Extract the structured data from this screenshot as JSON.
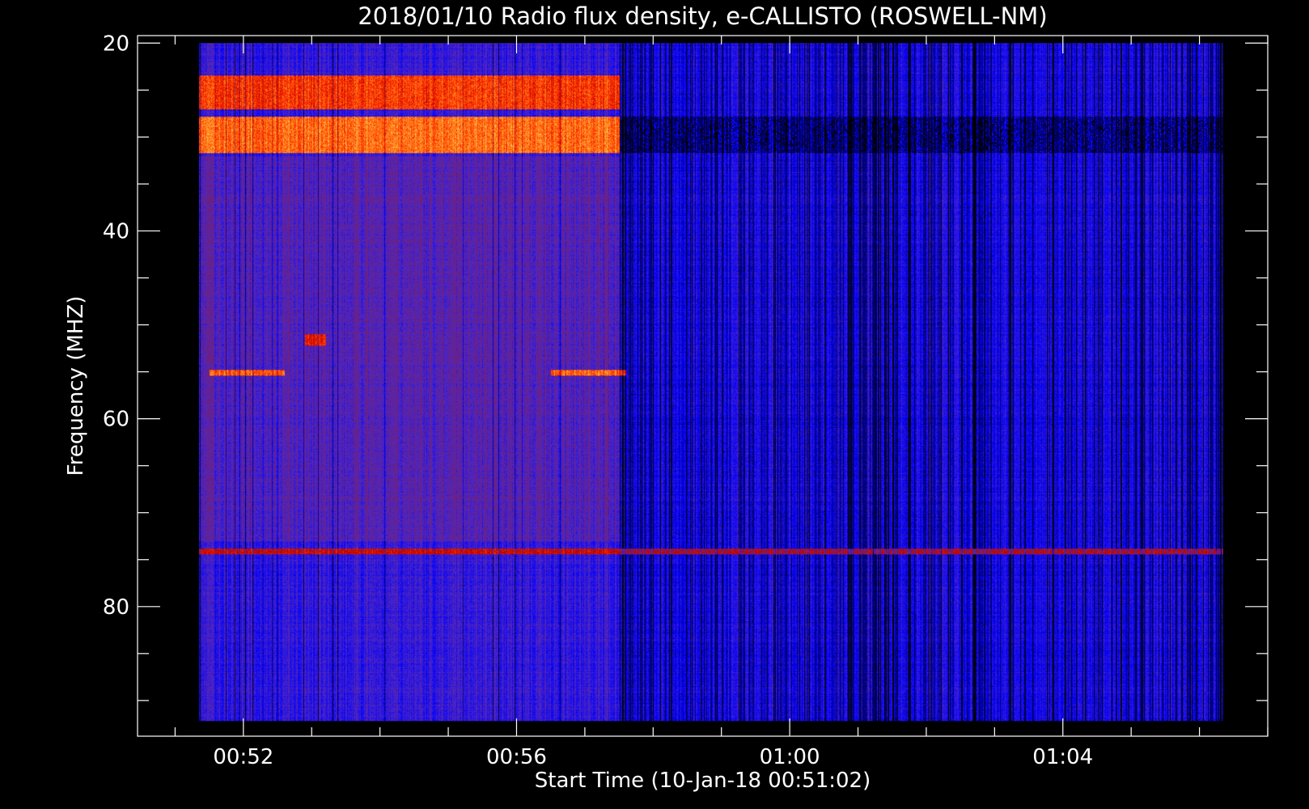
{
  "chart_data": {
    "type": "heatmap",
    "title": "2018/01/10  Radio flux density, e-CALLISTO (ROSWELL-NM)",
    "xlabel": "Start Time (10-Jan-18 00:51:02)",
    "ylabel": "Frequency (MHZ)",
    "x_range_minutes": [
      50.45,
      67.0
    ],
    "data_range_minutes": [
      51.35,
      66.35
    ],
    "ylim": [
      19.2,
      93.8
    ],
    "freq_range_mhz": [
      20,
      92.2
    ],
    "x_ticks": [
      {
        "value": 52,
        "label": "00:52"
      },
      {
        "value": 56,
        "label": "00:56"
      },
      {
        "value": 60,
        "label": "01:00"
      },
      {
        "value": 64,
        "label": "01:04"
      }
    ],
    "y_ticks": [
      {
        "value": 20,
        "label": "20"
      },
      {
        "value": 40,
        "label": "40"
      },
      {
        "value": 60,
        "label": "60"
      },
      {
        "value": 80,
        "label": "80"
      }
    ],
    "x_minor_step": 1,
    "y_minor_step": 5,
    "colormap": [
      "#000000",
      "#0000ff",
      "#5028c0",
      "#8a1a40",
      "#c00000",
      "#ff3000",
      "#ff9020",
      "#ffe070"
    ],
    "features": [
      {
        "freq": [
          23.4,
          27.0
        ],
        "time": [
          51.35,
          57.5
        ],
        "level": 5.0,
        "desc": "intense band"
      },
      {
        "freq": [
          27.8,
          31.7
        ],
        "time": [
          51.35,
          57.5
        ],
        "level": 5.6,
        "desc": "intense band"
      },
      {
        "freq": [
          27.8,
          31.7
        ],
        "time": [
          57.5,
          66.35
        ],
        "level": 1.0,
        "desc": "weak band"
      },
      {
        "freq": [
          73.8,
          74.4
        ],
        "time": [
          51.35,
          66.35
        ],
        "level": 4.0,
        "desc": "narrow interference line"
      },
      {
        "freq": [
          51.0,
          52.2
        ],
        "time": [
          52.9,
          53.2
        ],
        "level": 4.5,
        "desc": "burst"
      },
      {
        "freq": [
          54.8,
          55.4
        ],
        "time": [
          51.5,
          52.6
        ],
        "level": 5.5,
        "desc": "burst"
      },
      {
        "freq": [
          54.8,
          55.4
        ],
        "time": [
          56.5,
          57.6
        ],
        "level": 5.5,
        "desc": "burst"
      }
    ]
  }
}
